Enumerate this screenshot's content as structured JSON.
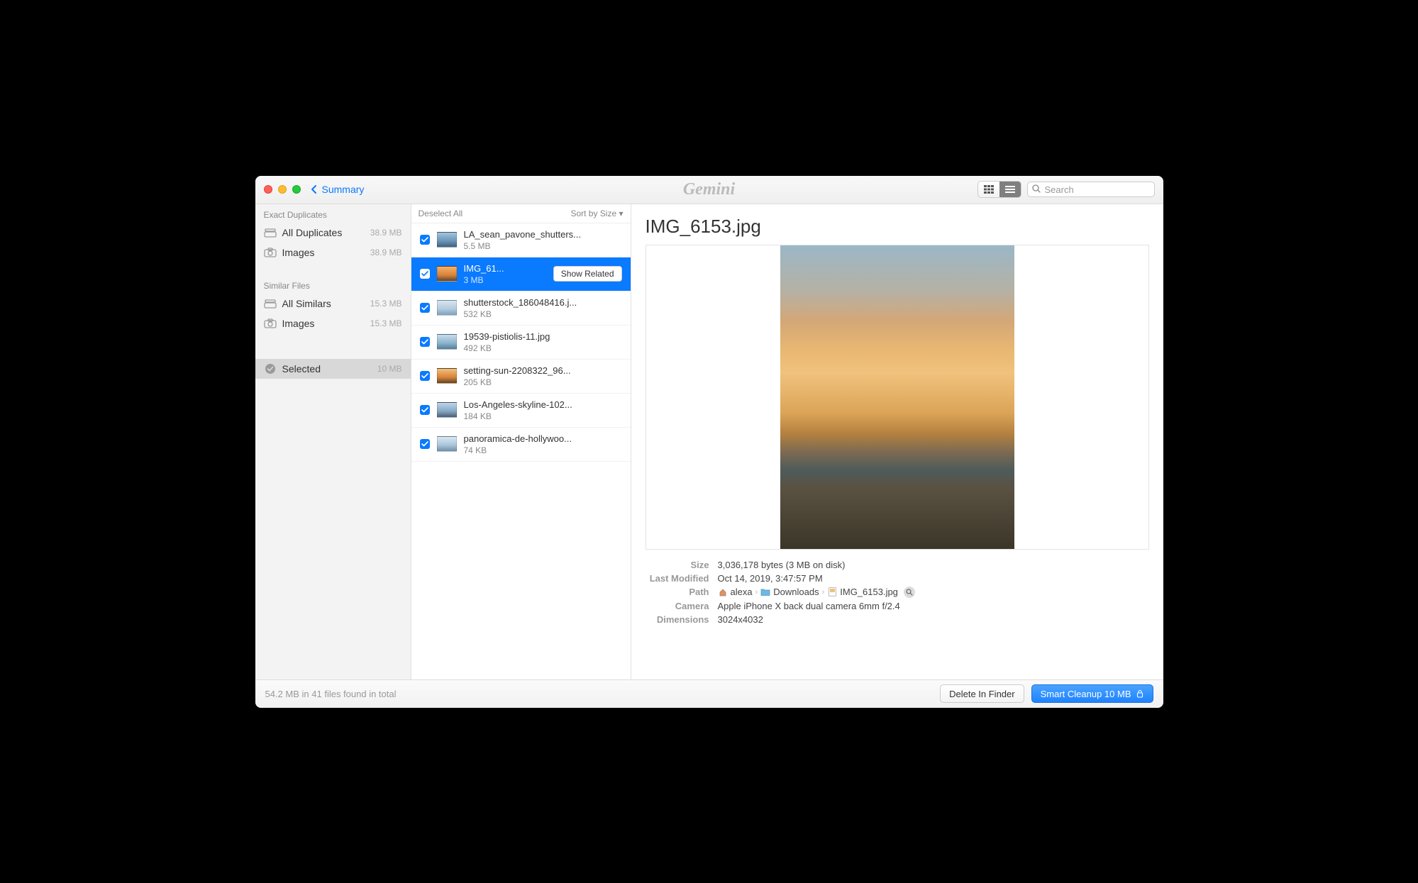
{
  "titlebar": {
    "back_label": "Summary",
    "app_name": "Gemini",
    "search_placeholder": "Search"
  },
  "sidebar": {
    "exact_title": "Exact Duplicates",
    "exact_items": [
      {
        "label": "All Duplicates",
        "badge": "38.9 MB"
      },
      {
        "label": "Images",
        "badge": "38.9 MB"
      }
    ],
    "similar_title": "Similar Files",
    "similar_items": [
      {
        "label": "All Similars",
        "badge": "15.3 MB"
      },
      {
        "label": "Images",
        "badge": "15.3 MB"
      }
    ],
    "selected_label": "Selected",
    "selected_badge": "10 MB"
  },
  "filelist": {
    "deselect_label": "Deselect All",
    "sort_label": "Sort by Size ▾",
    "show_related_label": "Show Related",
    "items": [
      {
        "name": "LA_sean_pavone_shutters...",
        "size": "5.5 MB"
      },
      {
        "name": "IMG_61...",
        "size": "3 MB",
        "selected": true
      },
      {
        "name": "shutterstock_186048416.j...",
        "size": "532 KB"
      },
      {
        "name": "19539-pistiolis-11.jpg",
        "size": "492 KB"
      },
      {
        "name": "setting-sun-2208322_96...",
        "size": "205 KB"
      },
      {
        "name": "Los-Angeles-skyline-102...",
        "size": "184 KB"
      },
      {
        "name": "panoramica-de-hollywoo...",
        "size": "74 KB"
      }
    ]
  },
  "preview": {
    "title": "IMG_6153.jpg",
    "meta": {
      "size_label": "Size",
      "size_value": "3,036,178 bytes (3 MB on disk)",
      "modified_label": "Last Modified",
      "modified_value": "Oct 14, 2019, 3:47:57 PM",
      "path_label": "Path",
      "path_user": "alexa",
      "path_folder": "Downloads",
      "path_file": "IMG_6153.jpg",
      "camera_label": "Camera",
      "camera_value": "Apple iPhone X back dual camera 6mm f/2.4",
      "dimensions_label": "Dimensions",
      "dimensions_value": "3024x4032"
    }
  },
  "footer": {
    "status": "54.2 MB in 41 files found in total",
    "delete_label": "Delete In Finder",
    "cleanup_label": "Smart Cleanup 10 MB"
  }
}
